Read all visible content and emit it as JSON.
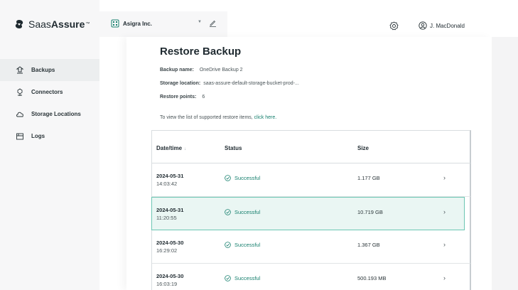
{
  "brand": {
    "name_light": "Saas",
    "name_bold": "Assure",
    "trademark": "™"
  },
  "tenant": {
    "name": "Asigra Inc."
  },
  "user": {
    "name": "J. MacDonald"
  },
  "nav": [
    {
      "label": "Backups",
      "icon": "backups-icon",
      "active": true
    },
    {
      "label": "Connectors",
      "icon": "connectors-icon",
      "active": false
    },
    {
      "label": "Storage Locations",
      "icon": "cloud-icon",
      "active": false
    },
    {
      "label": "Logs",
      "icon": "logs-icon",
      "active": false
    }
  ],
  "page": {
    "title": "Restore Backup",
    "backup_name_label": "Backup name:",
    "backup_name": "OneDrive Backup 2",
    "storage_location_label": "Storage location:",
    "storage_location": "saas-assure-default-storage-bucket-prod-...",
    "restore_points_label": "Restore points:",
    "restore_points": "6",
    "hint_text": "To view the list of supported restore items, ",
    "hint_link": "click here."
  },
  "table": {
    "columns": {
      "datetime": "Date/time",
      "status": "Status",
      "size": "Size"
    },
    "sort_glyph": "↓",
    "rows": [
      {
        "date": "2024-05-31",
        "time": "14:03:42",
        "status": "Successful",
        "size": "1.177 GB",
        "highlighted": false
      },
      {
        "date": "2024-05-31",
        "time": "11:20:55",
        "status": "Successful",
        "size": "10.719 GB",
        "highlighted": true
      },
      {
        "date": "2024-05-30",
        "time": "16:29:02",
        "status": "Successful",
        "size": "1.367 GB",
        "highlighted": false
      },
      {
        "date": "2024-05-30",
        "time": "16:03:19",
        "status": "Successful",
        "size": "500.193 MB",
        "highlighted": false
      }
    ]
  },
  "colors": {
    "accent": "#157f6d",
    "highlight_bg": "#eaf6f3",
    "highlight_border": "#6cc6b3"
  }
}
